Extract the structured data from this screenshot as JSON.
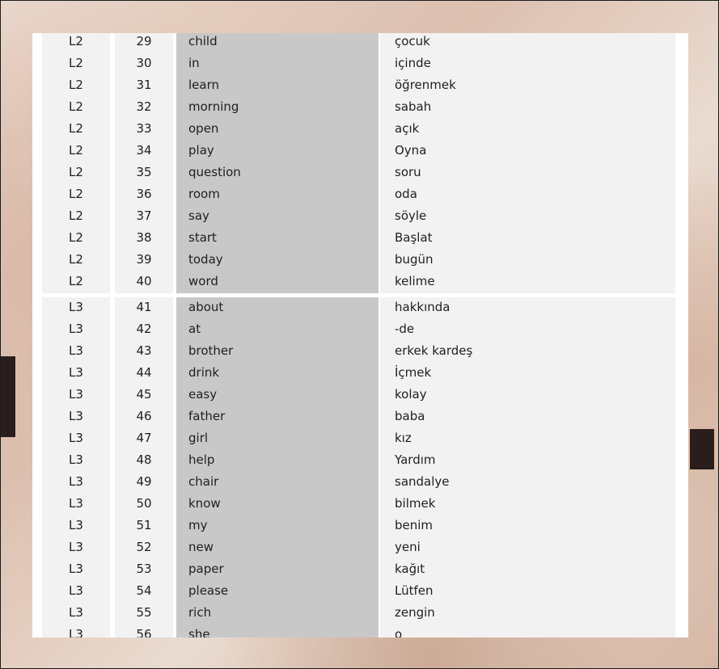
{
  "table": {
    "groups": [
      {
        "rows": [
          {
            "level": "L2",
            "num": "29",
            "en": "child",
            "tr": "çocuk"
          },
          {
            "level": "L2",
            "num": "30",
            "en": "in",
            "tr": "içinde"
          },
          {
            "level": "L2",
            "num": "31",
            "en": "learn",
            "tr": "öğrenmek"
          },
          {
            "level": "L2",
            "num": "32",
            "en": "morning",
            "tr": "sabah"
          },
          {
            "level": "L2",
            "num": "33",
            "en": "open",
            "tr": "açık"
          },
          {
            "level": "L2",
            "num": "34",
            "en": "play",
            "tr": "Oyna"
          },
          {
            "level": "L2",
            "num": "35",
            "en": "question",
            "tr": "soru"
          },
          {
            "level": "L2",
            "num": "36",
            "en": "room",
            "tr": "oda"
          },
          {
            "level": "L2",
            "num": "37",
            "en": "say",
            "tr": "söyle"
          },
          {
            "level": "L2",
            "num": "38",
            "en": "start",
            "tr": "Başlat"
          },
          {
            "level": "L2",
            "num": "39",
            "en": "today",
            "tr": "bugün"
          },
          {
            "level": "L2",
            "num": "40",
            "en": "word",
            "tr": "kelime"
          }
        ]
      },
      {
        "rows": [
          {
            "level": "L3",
            "num": "41",
            "en": "about",
            "tr": "hakkında"
          },
          {
            "level": "L3",
            "num": "42",
            "en": "at",
            "tr": "-de"
          },
          {
            "level": "L3",
            "num": "43",
            "en": "brother",
            "tr": "erkek kardeş"
          },
          {
            "level": "L3",
            "num": "44",
            "en": "drink",
            "tr": "İçmek"
          },
          {
            "level": "L3",
            "num": "45",
            "en": "easy",
            "tr": "kolay"
          },
          {
            "level": "L3",
            "num": "46",
            "en": "father",
            "tr": "baba"
          },
          {
            "level": "L3",
            "num": "47",
            "en": "girl",
            "tr": "kız"
          },
          {
            "level": "L3",
            "num": "48",
            "en": "help",
            "tr": "Yardım"
          },
          {
            "level": "L3",
            "num": "49",
            "en": "chair",
            "tr": "sandalye"
          },
          {
            "level": "L3",
            "num": "50",
            "en": "know",
            "tr": "bilmek"
          },
          {
            "level": "L3",
            "num": "51",
            "en": "my",
            "tr": "benim"
          },
          {
            "level": "L3",
            "num": "52",
            "en": "new",
            "tr": "yeni"
          },
          {
            "level": "L3",
            "num": "53",
            "en": "paper",
            "tr": "kağıt"
          },
          {
            "level": "L3",
            "num": "54",
            "en": "please",
            "tr": "Lütfen"
          },
          {
            "level": "L3",
            "num": "55",
            "en": "rich",
            "tr": "zengin"
          },
          {
            "level": "L3",
            "num": "56",
            "en": "she",
            "tr": "o"
          }
        ]
      }
    ]
  }
}
